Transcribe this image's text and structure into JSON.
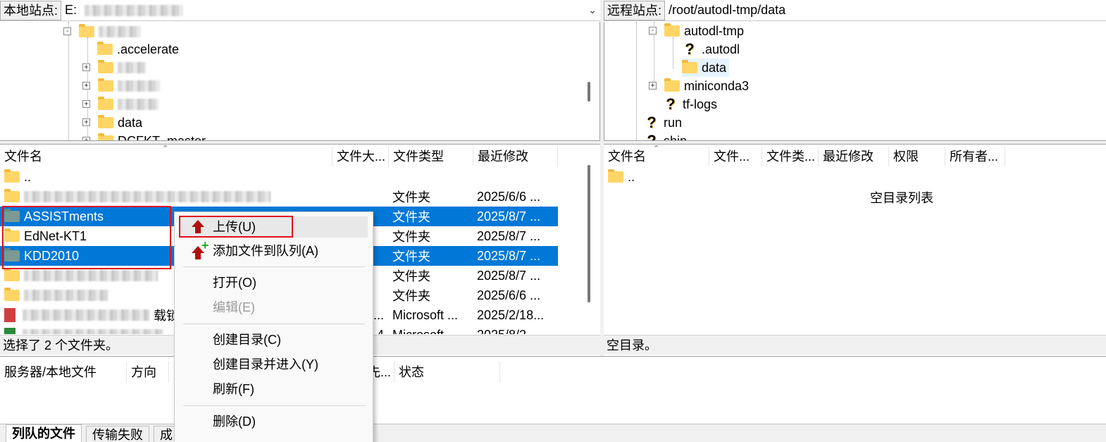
{
  "local": {
    "site_label": "本地站点:",
    "site_path": "E:",
    "tree": [
      {
        "label": ".accelerate",
        "expander": ""
      },
      {
        "label": "data",
        "expander": "+"
      },
      {
        "label": "DCFKT_master",
        "expander": "+"
      }
    ],
    "list": {
      "headers": [
        "文件名",
        "文件大...",
        "文件类型",
        "最近修改"
      ],
      "rows": [
        {
          "name": "..",
          "size": "",
          "type": "",
          "modified": "",
          "selected": false
        },
        {
          "name": "",
          "size": "",
          "type": "文件夹",
          "modified": "2025/6/6 ...",
          "selected": false
        },
        {
          "name": "ASSISTments",
          "size": "",
          "type": "文件夹",
          "modified": "2025/8/7 ...",
          "selected": true
        },
        {
          "name": "EdNet-KT1",
          "size": "",
          "type": "文件夹",
          "modified": "2025/8/7 ...",
          "selected": false
        },
        {
          "name": "KDD2010",
          "size": "",
          "type": "文件夹",
          "modified": "2025/8/7 ...",
          "selected": true
        },
        {
          "name": "",
          "size": "",
          "type": "文件夹",
          "modified": "2025/8/7 ...",
          "selected": false
        },
        {
          "name": "",
          "size": "",
          "type": "文件夹",
          "modified": "2025/6/6 ...",
          "selected": false
        },
        {
          "name": "载锁",
          "size": "...",
          "type": "Microsoft ...",
          "modified": "2025/2/18...",
          "selected": false
        },
        {
          "name": "",
          "size": "4",
          "type": "Microsoft ...",
          "modified": "2025/8/2...",
          "selected": false
        }
      ]
    },
    "status": "选择了 2 个文件夹。"
  },
  "remote": {
    "site_label": "远程站点:",
    "site_path": "/root/autodl-tmp/data",
    "tree": [
      {
        "label": "autodl-tmp",
        "icon": "folder",
        "expander": "-"
      },
      {
        "label": ".autodl",
        "icon": "question",
        "expander": ""
      },
      {
        "label": "data",
        "icon": "folder",
        "expander": ""
      },
      {
        "label": "miniconda3",
        "icon": "folder",
        "expander": "+"
      },
      {
        "label": "tf-logs",
        "icon": "question",
        "expander": ""
      },
      {
        "label": "run",
        "icon": "question",
        "expander": ""
      },
      {
        "label": "shin",
        "icon": "question",
        "expander": ""
      }
    ],
    "list": {
      "headers": [
        "文件名",
        "文件...",
        "文件类...",
        "最近修改",
        "权限",
        "所有者..."
      ],
      "rows": [
        {
          "name": ".."
        }
      ],
      "empty_text": "空目录列表"
    },
    "status": "空目录。"
  },
  "queue": {
    "headers": [
      "服务器/本地文件",
      "方向",
      "先...",
      "状态"
    ]
  },
  "tabs": [
    {
      "label": "列队的文件",
      "active": true
    },
    {
      "label": "传输失败",
      "active": false
    },
    {
      "label": "成",
      "active": false
    }
  ],
  "context_menu": {
    "items": [
      {
        "label": "上传(U)",
        "icon": "upload-icon",
        "highlighted": true,
        "disabled": false
      },
      {
        "label": "添加文件到队列(A)",
        "icon": "add-to-queue-icon",
        "highlighted": false,
        "disabled": false
      },
      {
        "label": "打开(O)",
        "highlighted": false,
        "disabled": false
      },
      {
        "label": "编辑(E)",
        "highlighted": false,
        "disabled": true
      },
      {
        "label": "创建目录(C)",
        "highlighted": false,
        "disabled": false
      },
      {
        "label": "创建目录并进入(Y)",
        "highlighted": false,
        "disabled": false
      },
      {
        "label": "刷新(F)",
        "highlighted": false,
        "disabled": false
      },
      {
        "label": "删除(D)",
        "highlighted": false,
        "disabled": false
      }
    ]
  },
  "colors": {
    "selection": "#0078d7",
    "highlight_box": "#e0101c",
    "folder": "#ffd566"
  }
}
